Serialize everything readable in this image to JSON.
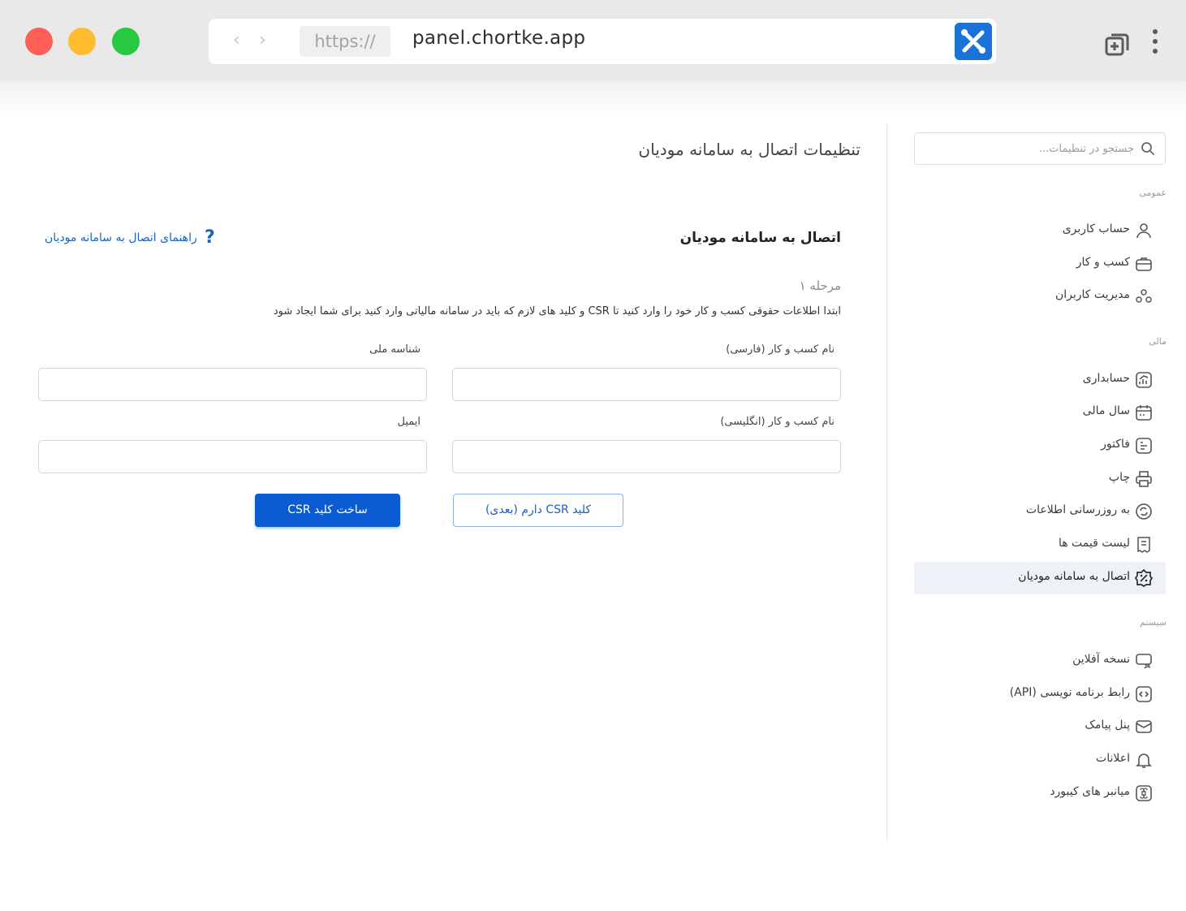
{
  "browser": {
    "scheme": "https://",
    "host": "panel.chortke.app",
    "colors": {
      "close": "#ff5f57",
      "minimize": "#febc2e",
      "maximize": "#28c840",
      "app_logo": "#1a73d9"
    }
  },
  "sidebar": {
    "search_placeholder": "جستجو در تنظیمات...",
    "sections": [
      {
        "title": "عمومی",
        "items": [
          {
            "label": "حساب کاربری",
            "icon": "user-icon"
          },
          {
            "label": "کسب و کار",
            "icon": "briefcase-icon"
          },
          {
            "label": "مدیریت کاربران",
            "icon": "users-icon"
          }
        ]
      },
      {
        "title": "مالی",
        "items": [
          {
            "label": "حسابداری",
            "icon": "chart-icon"
          },
          {
            "label": "سال مالی",
            "icon": "calendar-icon"
          },
          {
            "label": "فاکتور",
            "icon": "invoice-icon"
          },
          {
            "label": "چاپ",
            "icon": "printer-icon"
          },
          {
            "label": "به روزرسانی اطلاعات",
            "icon": "refresh-icon"
          },
          {
            "label": "لیست قیمت ها",
            "icon": "price-list-icon"
          },
          {
            "label": "اتصال به سامانه مودیان",
            "icon": "tax-percent-icon",
            "active": true
          }
        ]
      },
      {
        "title": "سیستم",
        "items": [
          {
            "label": "نسخه آفلاین",
            "icon": "offline-icon"
          },
          {
            "label": "رابط برنامه نویسی (API)",
            "icon": "api-icon"
          },
          {
            "label": "پنل پیامک",
            "icon": "sms-icon"
          },
          {
            "label": "اعلانات",
            "icon": "bell-icon"
          },
          {
            "label": "میانبر های کیبورد",
            "icon": "command-icon"
          }
        ]
      }
    ]
  },
  "main": {
    "page_title": "تنظیمات اتصال به سامانه مودیان",
    "section_heading": "اتصال به سامانه مودیان",
    "guide_link": "راهنمای اتصال به سامانه مودیان",
    "help_symbol": "?",
    "step": "مرحله ۱",
    "description": "ابتدا اطلاعات حقوقی کسب و کار خود را وارد کنید تا CSR و کلید های لازم که باید در سامانه مالیاتی وارد کنید برای شما ایجاد شود",
    "fields": {
      "business_name_fa": {
        "label": "نام کسب و کار (فارسی)",
        "value": ""
      },
      "national_id": {
        "label": "شناسه ملی",
        "value": ""
      },
      "business_name_en": {
        "label": "نام کسب و کار (انگلیسی)",
        "value": ""
      },
      "email": {
        "label": "ایمیل",
        "value": ""
      }
    },
    "buttons": {
      "have_csr": "کلید CSR دارم (بعدی)",
      "create_csr": "ساخت کلید CSR"
    },
    "colors": {
      "primary": "#0b5bd3",
      "link": "#1565c0",
      "active_bg": "#eef1f8"
    }
  }
}
